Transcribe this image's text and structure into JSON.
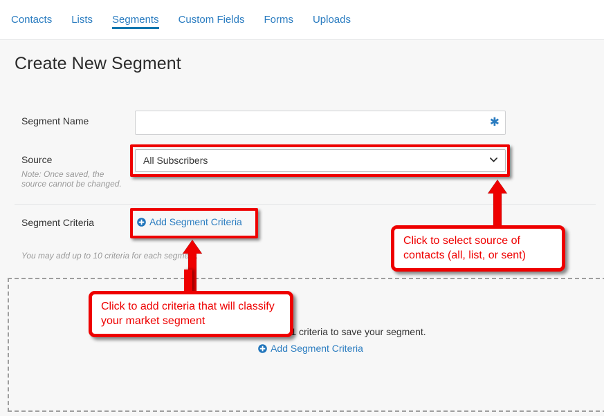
{
  "nav": {
    "tabs": [
      {
        "label": "Contacts",
        "active": false
      },
      {
        "label": "Lists",
        "active": false
      },
      {
        "label": "Segments",
        "active": true
      },
      {
        "label": "Custom Fields",
        "active": false
      },
      {
        "label": "Forms",
        "active": false
      },
      {
        "label": "Uploads",
        "active": false
      }
    ]
  },
  "page": {
    "title": "Create New Segment"
  },
  "form": {
    "segment_name": {
      "label": "Segment Name",
      "value": "",
      "placeholder": "",
      "required_marker": "✱"
    },
    "source": {
      "label": "Source",
      "note": "Note: Once saved, the source cannot be changed.",
      "selected": "All Subscribers",
      "options": [
        "All Subscribers"
      ]
    },
    "criteria": {
      "label": "Segment Criteria",
      "add_label": "Add Segment Criteria",
      "hint": "You may add up to 10 criteria for each segment."
    }
  },
  "empty_state": {
    "message": "You must add at least 1 criteria to save your segment.",
    "add_label": "Add Segment Criteria"
  },
  "annotations": {
    "source_callout": "Click to select source of contacts (all, list, or sent)",
    "criteria_callout": "Click to add criteria that will classify your market segment"
  },
  "colors": {
    "link": "#2a7cc0",
    "tab_active_underline": "#1277b0",
    "annotation_red": "#ee0000",
    "page_bg": "#f7f7f7",
    "header_bg": "#ffffff",
    "muted_text": "#9a9a9a"
  }
}
